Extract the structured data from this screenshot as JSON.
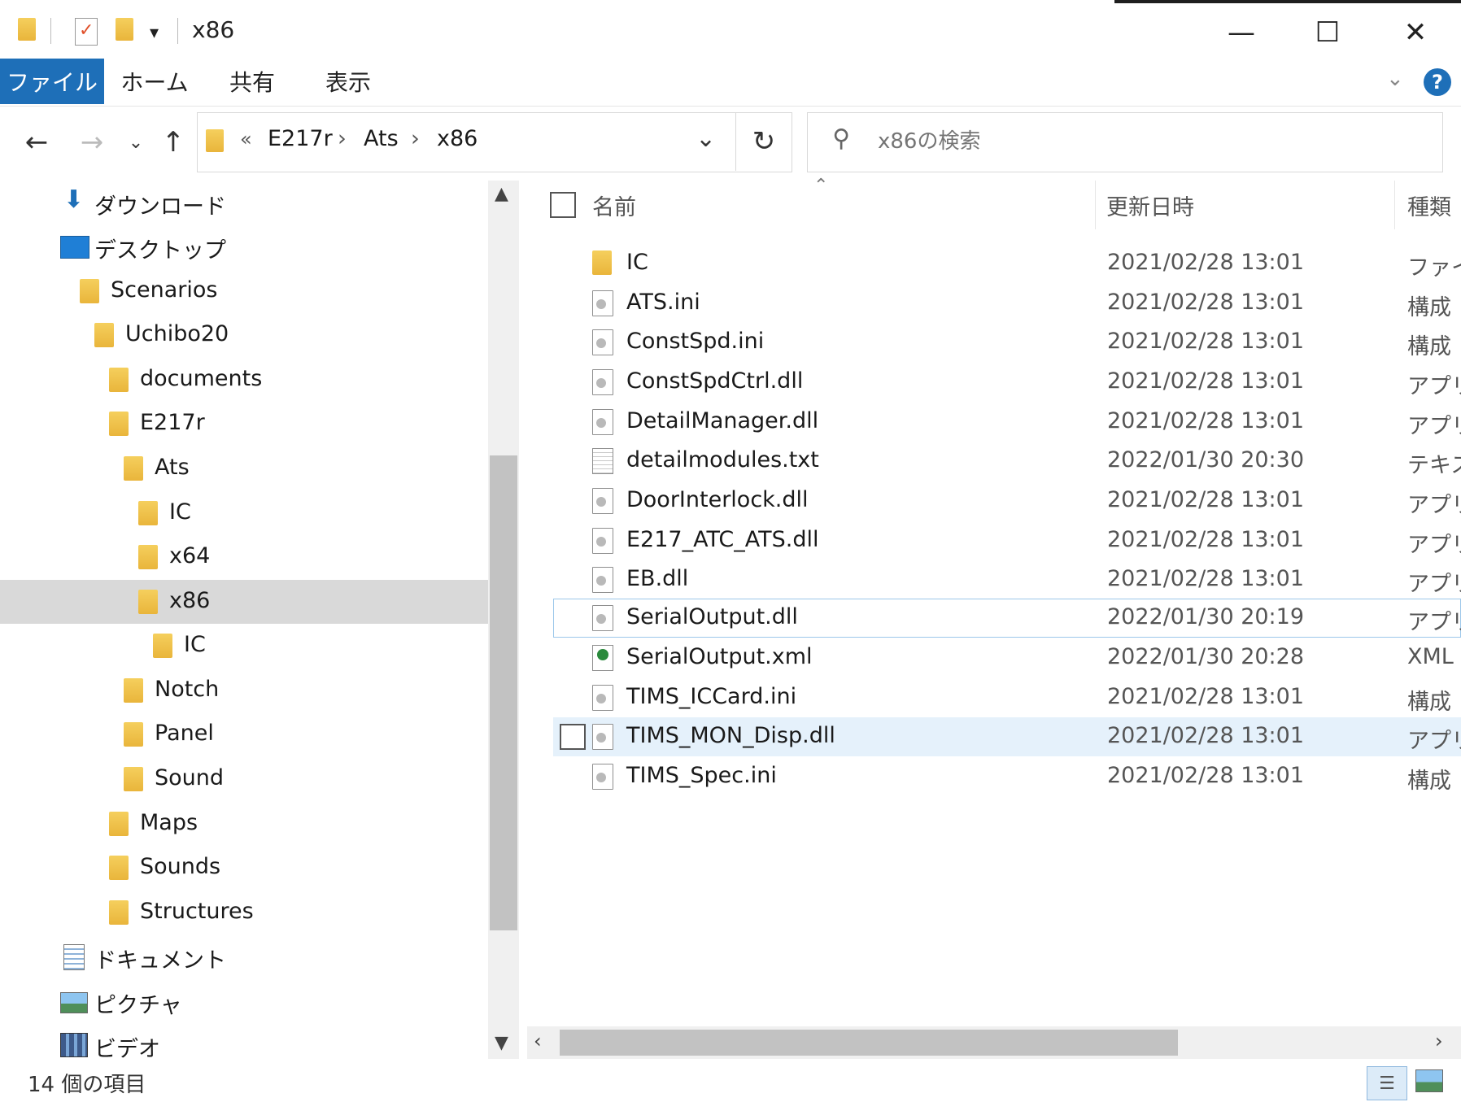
{
  "window": {
    "title": "x86",
    "minimize_glyph": "—",
    "maximize_glyph": "☐",
    "close_glyph": "✕"
  },
  "ribbon": {
    "tabs": [
      {
        "label": "ファイル",
        "active": true
      },
      {
        "label": "ホーム"
      },
      {
        "label": "共有"
      },
      {
        "label": "表示"
      }
    ],
    "help_glyph": "?"
  },
  "address_bar": {
    "overflow": "«",
    "crumbs": [
      "E217r",
      "Ats",
      "x86"
    ],
    "separator": "›"
  },
  "search": {
    "placeholder": "x86の検索"
  },
  "nav_pane": {
    "items": [
      {
        "label": "ダウンロード",
        "icon": "download-icon"
      },
      {
        "label": "デスクトップ",
        "icon": "desktop-icon"
      },
      {
        "label": "Scenarios",
        "icon": "folder-icon"
      },
      {
        "label": "Uchibo20",
        "icon": "folder-icon"
      },
      {
        "label": "documents",
        "icon": "folder-icon"
      },
      {
        "label": "E217r",
        "icon": "folder-icon"
      },
      {
        "label": "Ats",
        "icon": "folder-icon"
      },
      {
        "label": "IC",
        "icon": "folder-icon"
      },
      {
        "label": "x64",
        "icon": "folder-icon"
      },
      {
        "label": "x86",
        "icon": "folder-icon",
        "selected": true
      },
      {
        "label": "IC",
        "icon": "folder-icon"
      },
      {
        "label": "Notch",
        "icon": "folder-icon"
      },
      {
        "label": "Panel",
        "icon": "folder-icon"
      },
      {
        "label": "Sound",
        "icon": "folder-icon"
      },
      {
        "label": "Maps",
        "icon": "folder-icon"
      },
      {
        "label": "Sounds",
        "icon": "folder-icon"
      },
      {
        "label": "Structures",
        "icon": "folder-icon"
      },
      {
        "label": "ドキュメント",
        "icon": "documents-icon"
      },
      {
        "label": "ピクチャ",
        "icon": "pictures-icon"
      },
      {
        "label": "ビデオ",
        "icon": "videos-icon"
      }
    ]
  },
  "file_list": {
    "columns": {
      "name": "名前",
      "date": "更新日時",
      "type": "種類"
    },
    "files": [
      {
        "name": "IC",
        "date": "2021/02/28 13:01",
        "type": "ファイ",
        "icon": "folder-icon"
      },
      {
        "name": "ATS.ini",
        "date": "2021/02/28 13:01",
        "type": "構成",
        "icon": "settings-file-icon"
      },
      {
        "name": "ConstSpd.ini",
        "date": "2021/02/28 13:01",
        "type": "構成",
        "icon": "settings-file-icon"
      },
      {
        "name": "ConstSpdCtrl.dll",
        "date": "2021/02/28 13:01",
        "type": "アプリ",
        "icon": "dll-file-icon"
      },
      {
        "name": "DetailManager.dll",
        "date": "2021/02/28 13:01",
        "type": "アプリ",
        "icon": "dll-file-icon"
      },
      {
        "name": "detailmodules.txt",
        "date": "2022/01/30 20:30",
        "type": "テキス",
        "icon": "text-file-icon"
      },
      {
        "name": "DoorInterlock.dll",
        "date": "2021/02/28 13:01",
        "type": "アプリ",
        "icon": "dll-file-icon"
      },
      {
        "name": "E217_ATC_ATS.dll",
        "date": "2021/02/28 13:01",
        "type": "アプリ",
        "icon": "dll-file-icon"
      },
      {
        "name": "EB.dll",
        "date": "2021/02/28 13:01",
        "type": "アプリ",
        "icon": "dll-file-icon"
      },
      {
        "name": "SerialOutput.dll",
        "date": "2022/01/30 20:19",
        "type": "アプリ",
        "icon": "dll-file-icon",
        "focused": true
      },
      {
        "name": "SerialOutput.xml",
        "date": "2022/01/30 20:28",
        "type": "XML",
        "icon": "xml-file-icon"
      },
      {
        "name": "TIMS_ICCard.ini",
        "date": "2021/02/28 13:01",
        "type": "構成",
        "icon": "settings-file-icon"
      },
      {
        "name": "TIMS_MON_Disp.dll",
        "date": "2021/02/28 13:01",
        "type": "アプリ",
        "icon": "dll-file-icon",
        "hovered": true
      },
      {
        "name": "TIMS_Spec.ini",
        "date": "2021/02/28 13:01",
        "type": "構成",
        "icon": "settings-file-icon"
      }
    ]
  },
  "status_bar": {
    "item_count": "14 個の項目"
  },
  "colors": {
    "accent": "#1e6fb8",
    "selection": "#d9d9d9",
    "hover": "#e5f1fb",
    "folder": "#f0c24a"
  }
}
